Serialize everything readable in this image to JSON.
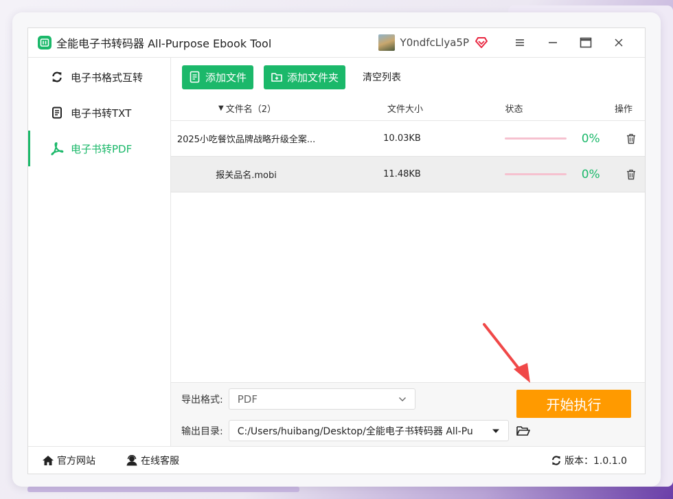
{
  "colors": {
    "accent": "#1bb86a",
    "start_button": "#ff9a00",
    "progress_track": "#f6c1cf",
    "annotation_arrow": "#f04848"
  },
  "titlebar": {
    "title": "全能电子书转码器 All-Purpose Ebook Tool",
    "user_name": "Y0ndfcLlya5P",
    "icons": [
      "app-logo-icon",
      "vip-heart-icon",
      "menu-icon",
      "minimize-icon",
      "maximize-icon",
      "close-icon"
    ]
  },
  "sidebar": {
    "items": [
      {
        "label": "电子书格式互转",
        "icon": "refresh-icon",
        "active": false
      },
      {
        "label": "电子书转TXT",
        "icon": "document-icon",
        "active": false
      },
      {
        "label": "电子书转PDF",
        "icon": "pdf-icon",
        "active": true
      }
    ]
  },
  "toolbar": {
    "add_file_label": "添加文件",
    "add_folder_label": "添加文件夹",
    "clear_label": "清空列表"
  },
  "table": {
    "headers": {
      "name": "文件名（2）",
      "size": "文件大小",
      "status": "状态",
      "action": "操作"
    },
    "rows": [
      {
        "name": "2025小吃餐饮品牌战略升级全案...",
        "size": "10.03KB",
        "progress": 0,
        "percent": "0%"
      },
      {
        "name": "报关品名.mobi",
        "size": "11.48KB",
        "progress": 0,
        "percent": "0%"
      }
    ]
  },
  "bottom": {
    "format_label": "导出格式:",
    "format_value": "PDF",
    "dir_label": "输出目录:",
    "dir_value": "C:/Users/huibang/Desktop/全能电子书转码器 All-Pu",
    "start_label": "开始执行"
  },
  "footer": {
    "website_label": "官方网站",
    "support_label": "在线客服",
    "version_label": "版本：1.0.1.0"
  }
}
